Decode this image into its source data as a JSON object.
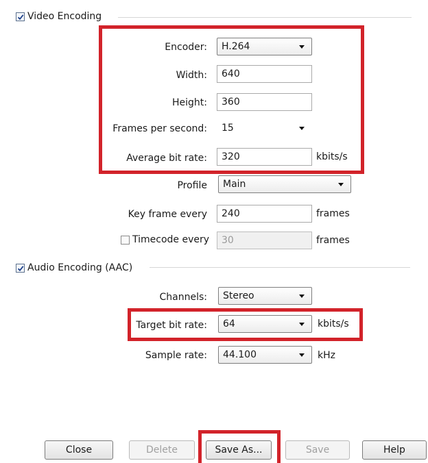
{
  "video": {
    "section_label": "Video Encoding",
    "checked": true,
    "encoder": {
      "label": "Encoder:",
      "value": "H.264"
    },
    "width": {
      "label": "Width:",
      "value": "640"
    },
    "height": {
      "label": "Height:",
      "value": "360"
    },
    "fps": {
      "label": "Frames per second:",
      "value": "15"
    },
    "bitrate": {
      "label": "Average bit rate:",
      "value": "320",
      "unit": "kbits/s"
    },
    "profile": {
      "label": "Profile",
      "value": "Main"
    },
    "keyframe": {
      "label": "Key frame every",
      "value": "240",
      "unit": "frames"
    },
    "timecode": {
      "label": "Timecode every",
      "checked": false,
      "value": "30",
      "unit": "frames"
    }
  },
  "audio": {
    "section_label": "Audio Encoding (AAC)",
    "checked": true,
    "channels": {
      "label": "Channels:",
      "value": "Stereo"
    },
    "target_bitrate": {
      "label": "Target bit rate:",
      "value": "64",
      "unit": "kbits/s"
    },
    "sample_rate": {
      "label": "Sample rate:",
      "value": "44.100",
      "unit": "kHz"
    }
  },
  "buttons": {
    "close": "Close",
    "delete": "Delete",
    "save_as": "Save As...",
    "save": "Save",
    "help": "Help"
  },
  "highlight_color": "#d2232a",
  "icons": {
    "checkbox_tick": "check-icon",
    "dropdown": "chevron-down-icon"
  }
}
